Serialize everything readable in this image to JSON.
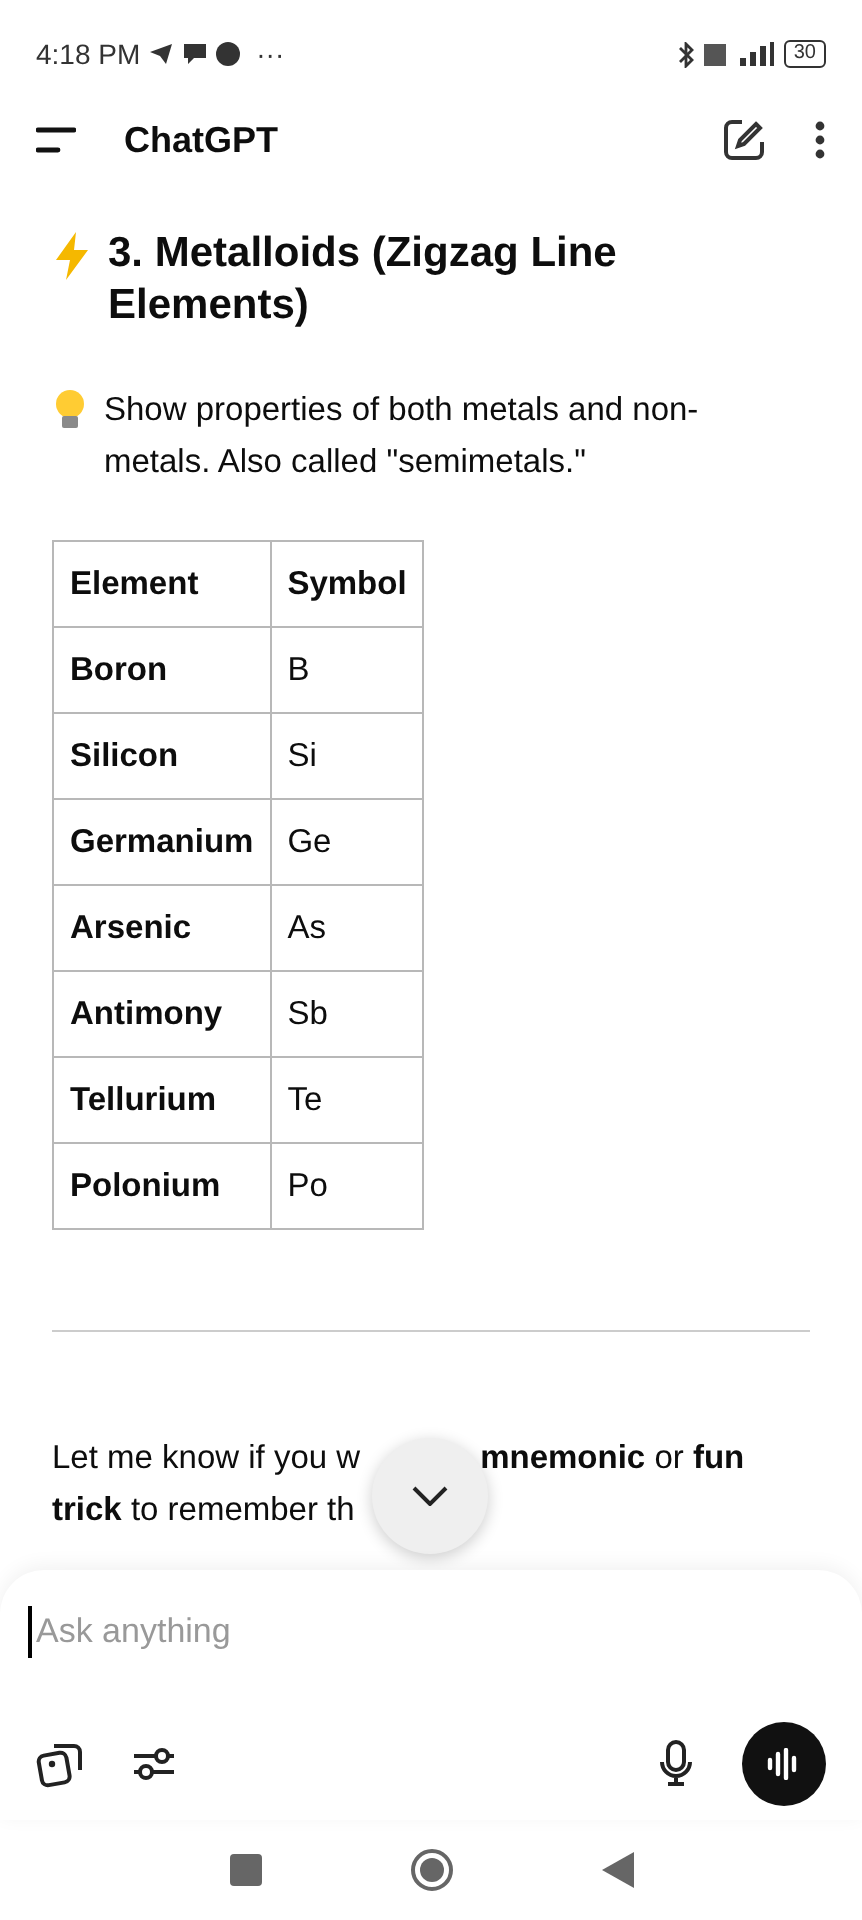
{
  "status_bar": {
    "time": "4:18 PM",
    "more": "···",
    "battery": "30"
  },
  "header": {
    "title": "ChatGPT"
  },
  "message": {
    "heading": "3. Metalloids (Zigzag Line Elements)",
    "intro": "Show properties of both metals and non-metals. Also called \"semimetals.\"",
    "table": {
      "columns": [
        "Element",
        "Symbol"
      ],
      "rows": [
        [
          "Boron",
          "B"
        ],
        [
          "Silicon",
          "Si"
        ],
        [
          "Germanium",
          "Ge"
        ],
        [
          "Arsenic",
          "As"
        ],
        [
          "Antimony",
          "Sb"
        ],
        [
          "Tellurium",
          "Te"
        ],
        [
          "Polonium",
          "Po"
        ]
      ]
    },
    "closing_lines": [
      [
        "Let me know if you w",
        "**mnemonic** or **fun**"
      ],
      [
        "**trick** to remember th"
      ]
    ]
  },
  "composer": {
    "placeholder": "Ask anything"
  }
}
